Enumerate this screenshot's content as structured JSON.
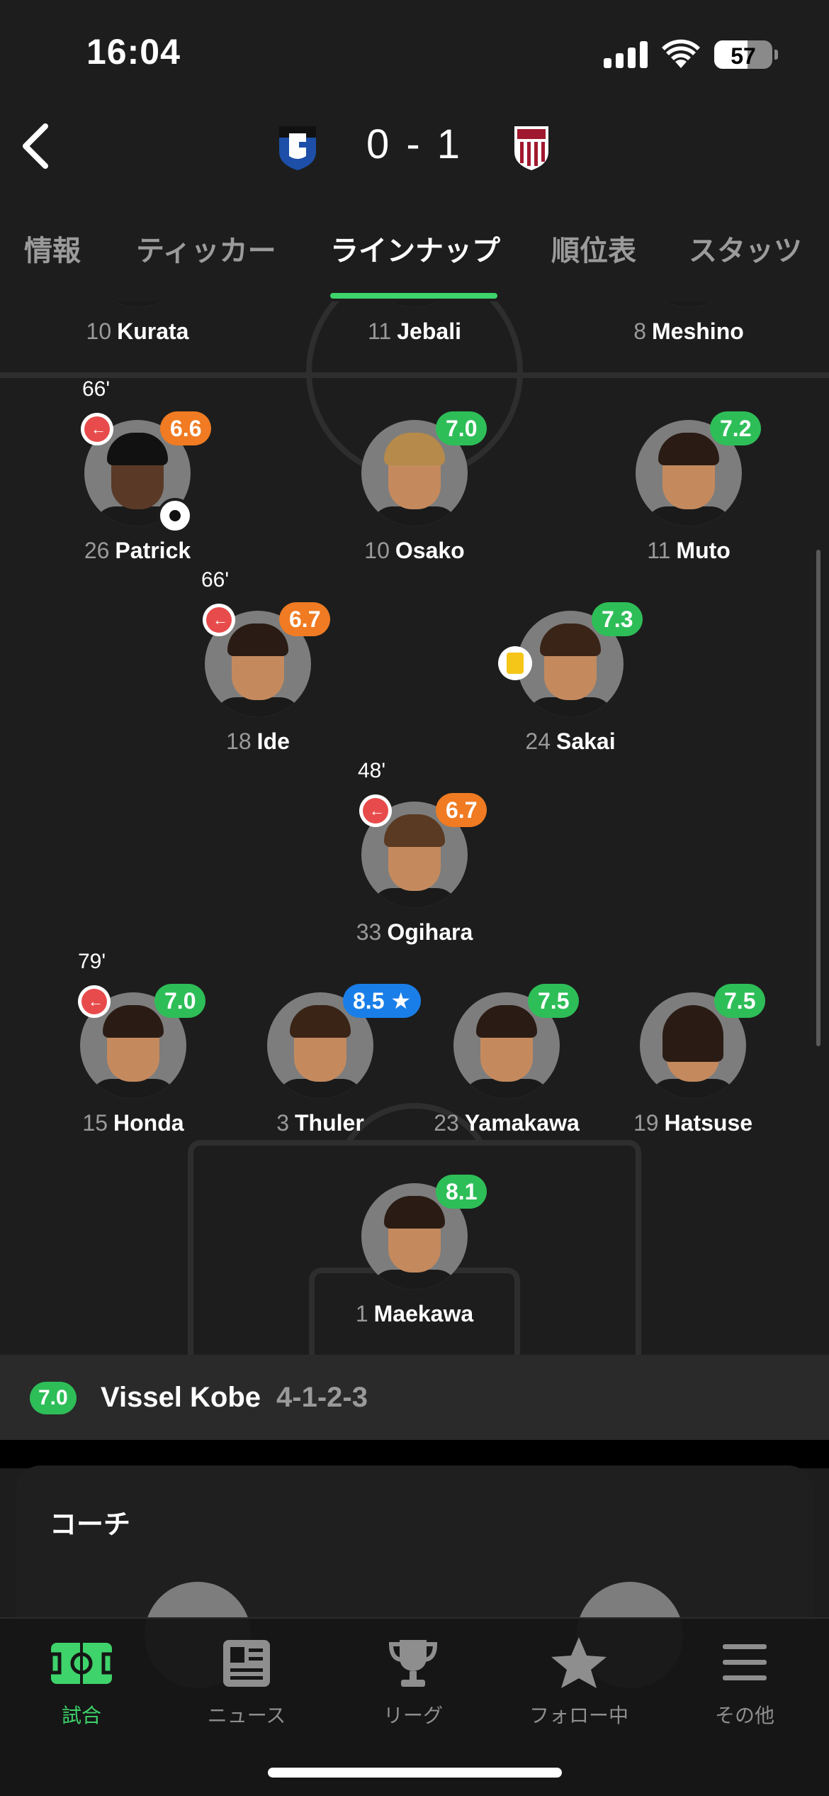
{
  "status_bar": {
    "time": "16:04",
    "battery": "57",
    "battery_level": 0.57
  },
  "match": {
    "home_score": "0",
    "separator": "-",
    "away_score": "1"
  },
  "tabs": [
    {
      "label": "情報"
    },
    {
      "label": "ティッカー"
    },
    {
      "label": "ラインナップ"
    },
    {
      "label": "順位表"
    },
    {
      "label": "スタッツ"
    }
  ],
  "active_tab": "ラインナップ",
  "players": {
    "kurata": {
      "number": "10",
      "name": "Kurata"
    },
    "jebali": {
      "number": "11",
      "name": "Jebali"
    },
    "meshino": {
      "number": "8",
      "name": "Meshino"
    },
    "patrick": {
      "number": "26",
      "name": "Patrick",
      "rating": "6.6",
      "sub_minute": "66'",
      "goal": true
    },
    "osako": {
      "number": "10",
      "name": "Osako",
      "rating": "7.0"
    },
    "muto": {
      "number": "11",
      "name": "Muto",
      "rating": "7.2"
    },
    "ide": {
      "number": "18",
      "name": "Ide",
      "rating": "6.7",
      "sub_minute": "66'"
    },
    "sakai": {
      "number": "24",
      "name": "Sakai",
      "rating": "7.3",
      "yellow_card": true
    },
    "ogihara": {
      "number": "33",
      "name": "Ogihara",
      "rating": "6.7",
      "sub_minute": "48'"
    },
    "honda": {
      "number": "15",
      "name": "Honda",
      "rating": "7.0",
      "sub_minute": "79'"
    },
    "thuler": {
      "number": "3",
      "name": "Thuler",
      "rating": "8.5 ★",
      "man_of_match": true
    },
    "yamakawa": {
      "number": "23",
      "name": "Yamakawa",
      "rating": "7.5"
    },
    "hatsuse": {
      "number": "19",
      "name": "Hatsuse",
      "rating": "7.5"
    },
    "maekawa": {
      "number": "1",
      "name": "Maekawa",
      "rating": "8.1"
    }
  },
  "team": {
    "rating": "7.0",
    "name": "Vissel Kobe",
    "formation": "4-1-2-3"
  },
  "coach_section": {
    "title": "コーチ"
  },
  "nav": [
    {
      "label": "試合",
      "icon": "pitch-icon",
      "active": true
    },
    {
      "label": "ニュース",
      "icon": "news-icon"
    },
    {
      "label": "リーグ",
      "icon": "trophy-icon"
    },
    {
      "label": "フォロー中",
      "icon": "star-icon"
    },
    {
      "label": "その他",
      "icon": "menu-icon"
    }
  ],
  "colors": {
    "accent": "#3ed36b",
    "rating_green": "#2ebe58",
    "rating_orange": "#f07b22",
    "rating_blue": "#1a7ee8",
    "sub_red": "#e84b4b"
  }
}
